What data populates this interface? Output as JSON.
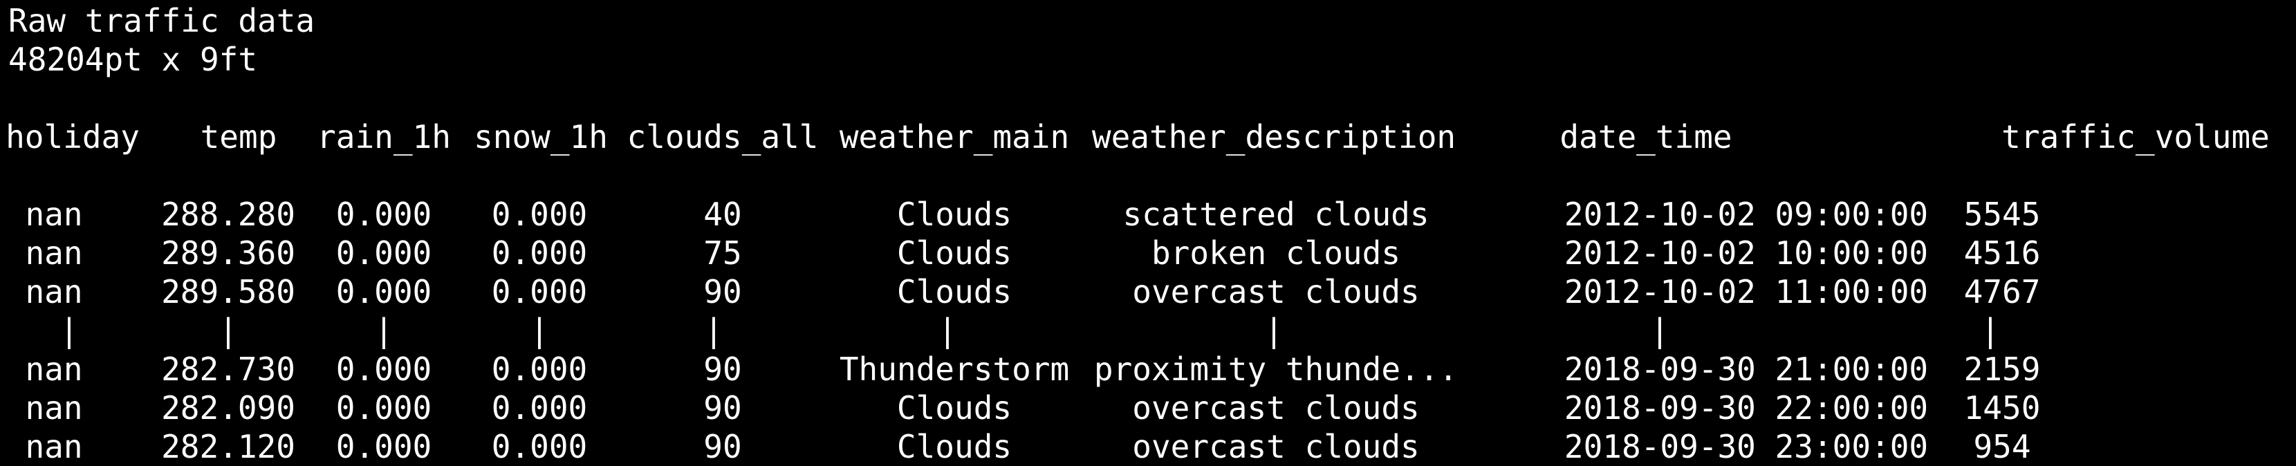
{
  "title": "Raw traffic data",
  "shape": "48204pt x 9ft",
  "columns": [
    "holiday",
    "temp",
    "rain_1h",
    "snow_1h",
    "clouds_all",
    "weather_main",
    "weather_description",
    "date_time",
    "traffic_volume"
  ],
  "rows_head": [
    [
      "nan",
      "288.280",
      "0.000",
      "0.000",
      "40",
      "Clouds",
      "scattered clouds",
      "2012-10-02 09:00:00",
      "5545"
    ],
    [
      "nan",
      "289.360",
      "0.000",
      "0.000",
      "75",
      "Clouds",
      "broken clouds",
      "2012-10-02 10:00:00",
      "4516"
    ],
    [
      "nan",
      "289.580",
      "0.000",
      "0.000",
      "90",
      "Clouds",
      "overcast clouds",
      "2012-10-02 11:00:00",
      "4767"
    ]
  ],
  "ellipsis_row": [
    "|",
    "|",
    "|",
    "|",
    "|",
    "|",
    "|",
    "|",
    "|"
  ],
  "rows_tail": [
    [
      "nan",
      "282.730",
      "0.000",
      "0.000",
      "90",
      "Thunderstorm",
      "proximity thunde...",
      "2018-09-30 21:00:00",
      "2159"
    ],
    [
      "nan",
      "282.090",
      "0.000",
      "0.000",
      "90",
      "Clouds",
      "overcast clouds",
      "2018-09-30 22:00:00",
      "1450"
    ],
    [
      "nan",
      "282.120",
      "0.000",
      "0.000",
      "90",
      "Clouds",
      "overcast clouds",
      "2018-09-30 23:00:00",
      "954"
    ]
  ]
}
